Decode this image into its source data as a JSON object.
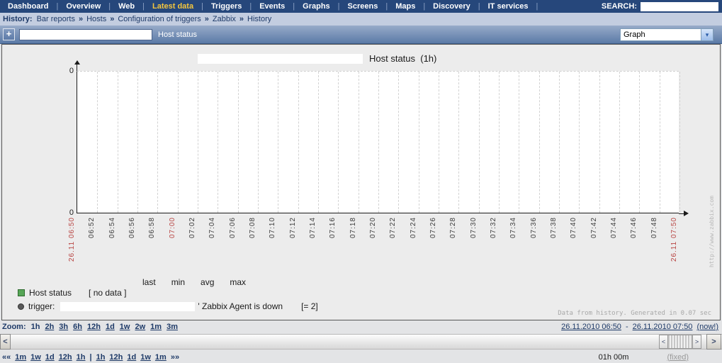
{
  "nav": {
    "items": [
      "Dashboard",
      "Overview",
      "Web",
      "Latest data",
      "Triggers",
      "Events",
      "Graphs",
      "Screens",
      "Maps",
      "Discovery",
      "IT services"
    ],
    "active_item": "Latest data",
    "search_label": "SEARCH:",
    "search_value": ""
  },
  "history": {
    "label": "History:",
    "separator": "»",
    "items": [
      "Bar reports",
      "Hosts",
      "Configuration of triggers",
      "Zabbix",
      "History"
    ]
  },
  "toolbar": {
    "add_button": "+",
    "graph_name_value": "",
    "graph_label": "Host status",
    "view_mode": "Graph",
    "select_chevron": "▾"
  },
  "chart_data": {
    "type": "line",
    "title": "Host status  (1h)",
    "series": [
      {
        "name": "Host status",
        "values": [],
        "note": "[ no data ]"
      }
    ],
    "ylim": [
      0,
      0
    ],
    "y_tick_top": "0",
    "y_tick_bottom": "0",
    "x_ticks": [
      "26.11 06:50",
      "06:52",
      "06:54",
      "06:56",
      "06:58",
      "07:00",
      "07:02",
      "07:04",
      "07:06",
      "07:08",
      "07:10",
      "07:12",
      "07:14",
      "07:16",
      "07:18",
      "07:20",
      "07:22",
      "07:24",
      "07:26",
      "07:28",
      "07:30",
      "07:32",
      "07:34",
      "07:36",
      "07:38",
      "07:40",
      "07:42",
      "07:44",
      "07:46",
      "07:48",
      "26.11 07:50"
    ],
    "x_tick_red": [
      0,
      5,
      30
    ],
    "grid": true,
    "legend_position": "bottom-left",
    "legend": {
      "headers": [
        "last",
        "min",
        "avg",
        "max"
      ],
      "rows": [
        {
          "swatch": "green-square",
          "color": "#57a657",
          "label": "Host status",
          "value": "[ no data ]"
        },
        {
          "swatch": "gray-circle",
          "color": "#5a5a5a",
          "label": "trigger:",
          "text": "' Zabbix Agent is down",
          "count": "[= 2]"
        }
      ]
    },
    "watermark": "http://www.zabbix.com",
    "footer": "Data from history. Generated in 0.07 sec"
  },
  "zoom": {
    "label": "Zoom:",
    "current": "1h",
    "links": [
      "2h",
      "3h",
      "6h",
      "12h",
      "1d",
      "1w",
      "2w",
      "1m",
      "3m"
    ],
    "range_start": "26.11.2010 06:50",
    "range_separator": "-",
    "range_end": "26.11.2010 07:50",
    "now_link": "(now!)"
  },
  "scrollbar": {
    "left_arrow": "<",
    "right_arrow": ">",
    "slider_left": "<",
    "slider_right": ">"
  },
  "timenav": {
    "rewind_all": "««",
    "back_links": [
      "1m",
      "1w",
      "1d",
      "12h",
      "1h"
    ],
    "separator": "|",
    "forward_links": [
      "1h",
      "12h",
      "1d",
      "1w",
      "1m"
    ],
    "forward_all": "»»",
    "window_length": "01h 00m",
    "fixed_link": "(fixed)"
  },
  "colors": {
    "nav_bg": "#26477b",
    "nav_active": "#f4c63e",
    "toolbar_top": "#97abc9",
    "toolbar_bottom": "#5b7aa7",
    "red_tick": "#b84442",
    "legend_green": "#57a657",
    "panel_bg": "#ececec"
  }
}
